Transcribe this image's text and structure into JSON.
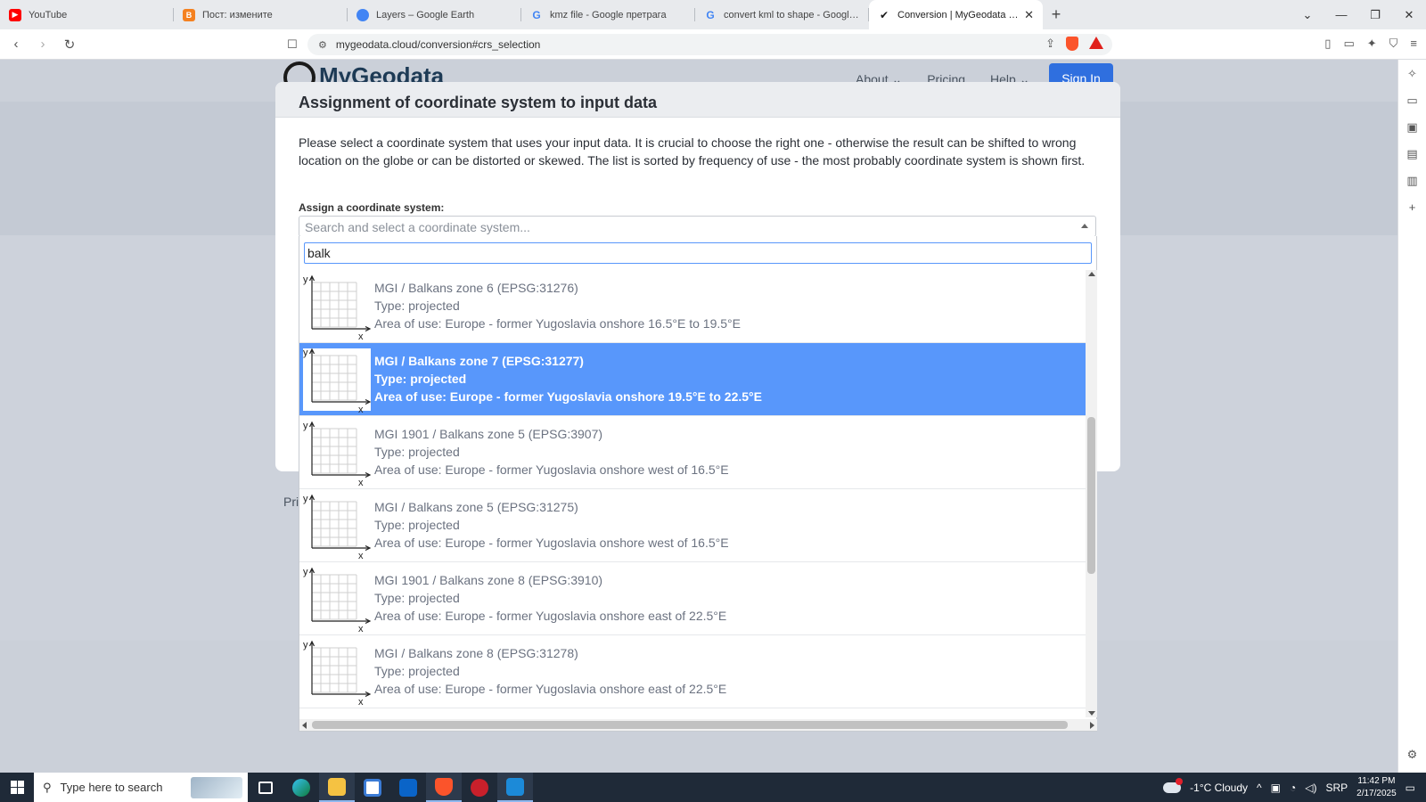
{
  "browser": {
    "tabs": [
      {
        "label": "YouTube",
        "favicon_color": "#ff0000",
        "favicon": "▶"
      },
      {
        "label": "Пост: измените",
        "favicon_color": "#f48120",
        "favicon": "B"
      },
      {
        "label": "Layers – Google Earth",
        "favicon_color": "#4285f4",
        "favicon": "●"
      },
      {
        "label": "kmz file - Google претрага",
        "favicon_color": "#ffffff",
        "favicon": "G"
      },
      {
        "label": "convert kml to shape - Google пре",
        "favicon_color": "#ffffff",
        "favicon": "G"
      },
      {
        "label": "Conversion | MyGeodata Conve",
        "favicon_color": "#ffffff",
        "favicon": "✔",
        "active": true
      }
    ],
    "url": "mygeodata.cloud/conversion#crs_selection"
  },
  "site": {
    "logo": "MyGeodata",
    "nav": [
      "About ⌄",
      "Pricing",
      "Help ⌄"
    ],
    "sign_in": "Sign In",
    "side_text": "Pri"
  },
  "modal": {
    "title": "Assignment of coordinate system to input data",
    "description": "Please select a coordinate system that uses your input data. It is crucial to choose the right one - otherwise the result can be shifted to wrong location on the globe or can be distorted or skewed. The list is sorted by frequency of use - the most probably coordinate system is shown first.",
    "assign_label": "Assign a coordinate system:",
    "select_placeholder": "Search and select a coordinate system..."
  },
  "dropdown": {
    "search_value": "balk",
    "axis_x": "x",
    "axis_y": "y",
    "results": [
      {
        "name": "MGI / Balkans zone 6 (EPSG:31276)",
        "type": "Type: projected",
        "area": "Area of use: Europe - former Yugoslavia onshore 16.5°E to 19.5°E",
        "highlighted": false
      },
      {
        "name": "MGI / Balkans zone 7 (EPSG:31277)",
        "type": "Type: projected",
        "area": "Area of use: Europe - former Yugoslavia onshore 19.5°E to 22.5°E",
        "highlighted": true
      },
      {
        "name": "MGI 1901 / Balkans zone 5 (EPSG:3907)",
        "type": "Type: projected",
        "area": "Area of use: Europe - former Yugoslavia onshore west of 16.5°E",
        "highlighted": false
      },
      {
        "name": "MGI / Balkans zone 5 (EPSG:31275)",
        "type": "Type: projected",
        "area": "Area of use: Europe - former Yugoslavia onshore west of 16.5°E",
        "highlighted": false
      },
      {
        "name": "MGI 1901 / Balkans zone 8 (EPSG:3910)",
        "type": "Type: projected",
        "area": "Area of use: Europe - former Yugoslavia onshore east of 22.5°E",
        "highlighted": false
      },
      {
        "name": "MGI / Balkans zone 8 (EPSG:31278)",
        "type": "Type: projected",
        "area": "Area of use: Europe - former Yugoslavia onshore east of 22.5°E",
        "highlighted": false
      }
    ]
  },
  "taskbar": {
    "search_placeholder": "Type here to search",
    "weather": "-1°C  Cloudy",
    "language": "SRP",
    "time": "11:42 PM",
    "date": "2/17/2025"
  },
  "colors": {
    "highlight": "#5897fb",
    "sign_in": "#2f6fdf"
  }
}
